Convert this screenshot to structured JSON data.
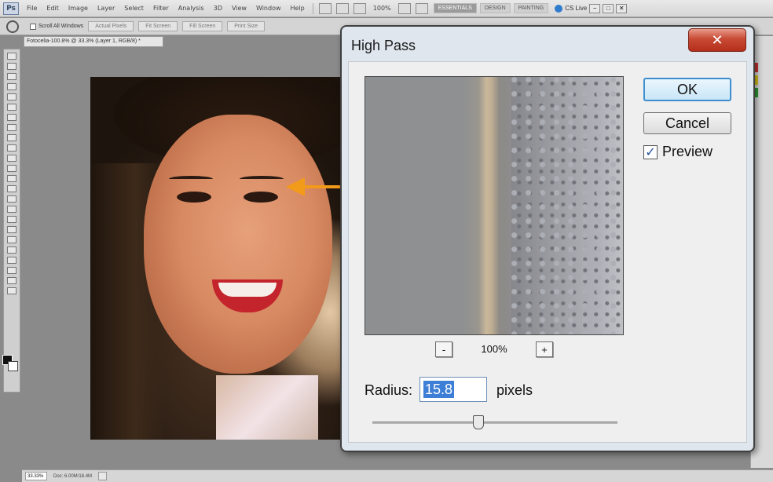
{
  "app": {
    "logo": "Ps",
    "menu": [
      "File",
      "Edit",
      "Image",
      "Layer",
      "Select",
      "Filter",
      "Analysis",
      "3D",
      "View",
      "Window",
      "Help"
    ],
    "zoom_menu": "100%",
    "workspaces": [
      "ESSENTIALS",
      "DESIGN",
      "PAINTING"
    ],
    "cs_live": "CS Live",
    "window_controls": [
      "−",
      "□",
      "✕"
    ]
  },
  "options_bar": {
    "scroll_all_windows": "Scroll All Windows",
    "buttons": [
      "Actual Pixels",
      "Fit Screen",
      "Fill Screen",
      "Print Size"
    ]
  },
  "document": {
    "tab_title": "Fotocelia-100.8% @ 33.3% (Layer 1, RGB/8) *",
    "zoom": "33.33%",
    "doc_info": "Doc: 6.00M/18.4M"
  },
  "dialog": {
    "title": "High Pass",
    "close_label": "✕",
    "ok_label": "OK",
    "cancel_label": "Cancel",
    "preview_label": "Preview",
    "preview_checked": "✓",
    "zoom_minus": "-",
    "zoom_plus": "+",
    "zoom_value": "100%",
    "radius_label": "Radius:",
    "radius_value": "15.8",
    "units_label": "pixels"
  },
  "colors": {
    "arrow": "#f29a1a",
    "close_button": "#c84a34",
    "selection": "#3d7fd6"
  }
}
